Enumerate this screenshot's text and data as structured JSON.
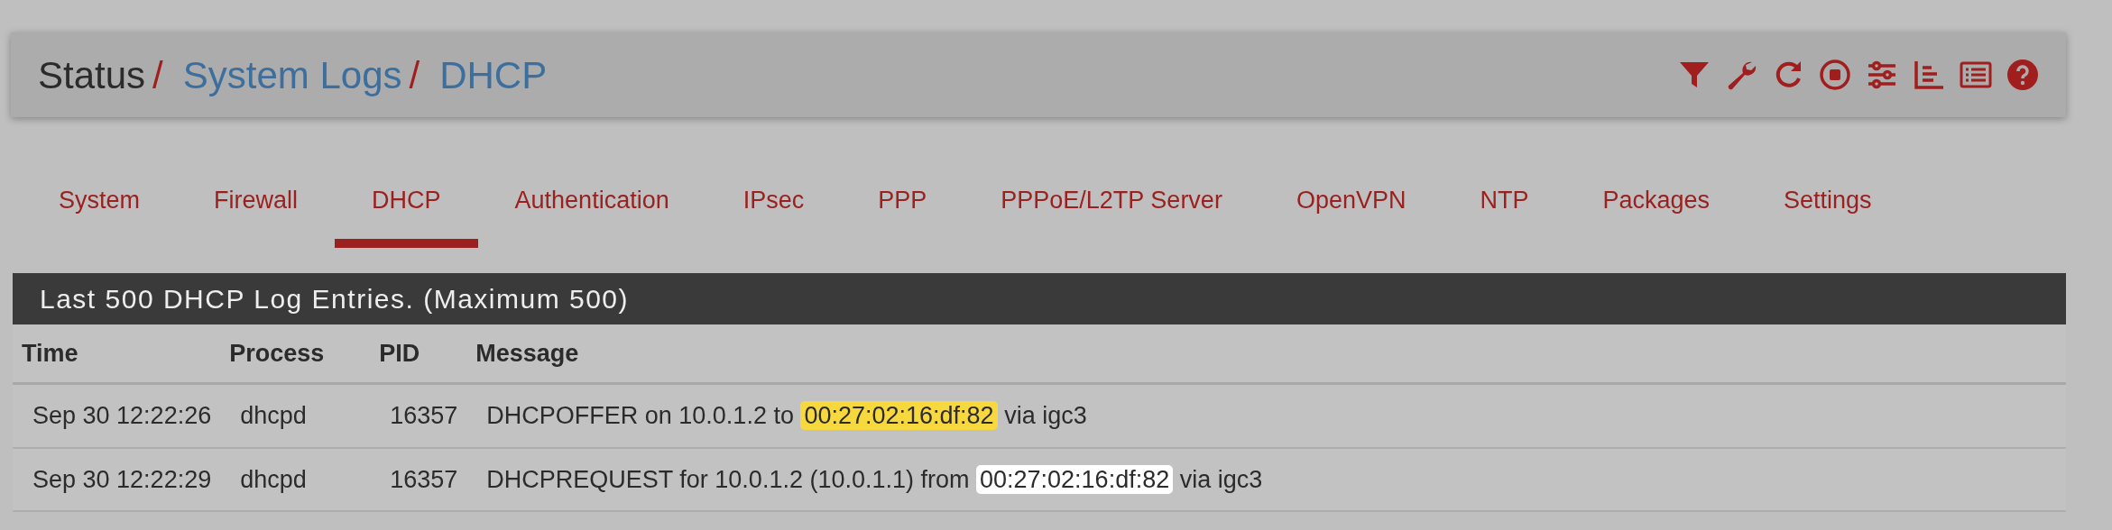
{
  "breadcrumb": [
    {
      "label": "Status",
      "link": false,
      "separator": "/"
    },
    {
      "label": "System Logs",
      "link": true,
      "separator": "/"
    },
    {
      "label": "DHCP",
      "link": true
    }
  ],
  "toolbar_icons": [
    {
      "kind": "filter"
    },
    {
      "kind": "wrench"
    },
    {
      "kind": "reload"
    },
    {
      "kind": "stop"
    },
    {
      "kind": "sliders"
    },
    {
      "kind": "chart"
    },
    {
      "kind": "list"
    },
    {
      "kind": "help"
    }
  ],
  "tabs": [
    {
      "label": "System",
      "selected": false
    },
    {
      "label": "Firewall",
      "selected": false
    },
    {
      "label": "DHCP",
      "selected": true
    },
    {
      "label": "Authentication",
      "selected": false
    },
    {
      "label": "IPsec",
      "selected": false
    },
    {
      "label": "PPP",
      "selected": false
    },
    {
      "label": "PPPoE/L2TP Server",
      "selected": false
    },
    {
      "label": "OpenVPN",
      "selected": false
    },
    {
      "label": "NTP",
      "selected": false
    },
    {
      "label": "Packages",
      "selected": false
    },
    {
      "label": "Settings",
      "selected": false
    }
  ],
  "panel": {
    "title": "Last 500 DHCP Log Entries. (Maximum 500)",
    "table": {
      "columns": [
        "Time",
        "Process",
        "PID",
        "Message"
      ],
      "rows": [
        {
          "time": "Sep 30 12:22:26",
          "process": "dhcpd",
          "pid": "16357",
          "message_before": "DHCPOFFER on 10.0.1.2 to",
          "mac": "00:27:02:16:df:82",
          "highlighted": true,
          "message_after": "via igc3"
        },
        {
          "time": "Sep 30 12:22:29",
          "process": "dhcpd",
          "pid": "16357",
          "message_before": "DHCPREQUEST for 10.0.1.2 (10.0.1.1) from",
          "mac": "00:27:02:16:df:82",
          "highlighted": false,
          "message_after": "via igc3"
        }
      ]
    }
  }
}
